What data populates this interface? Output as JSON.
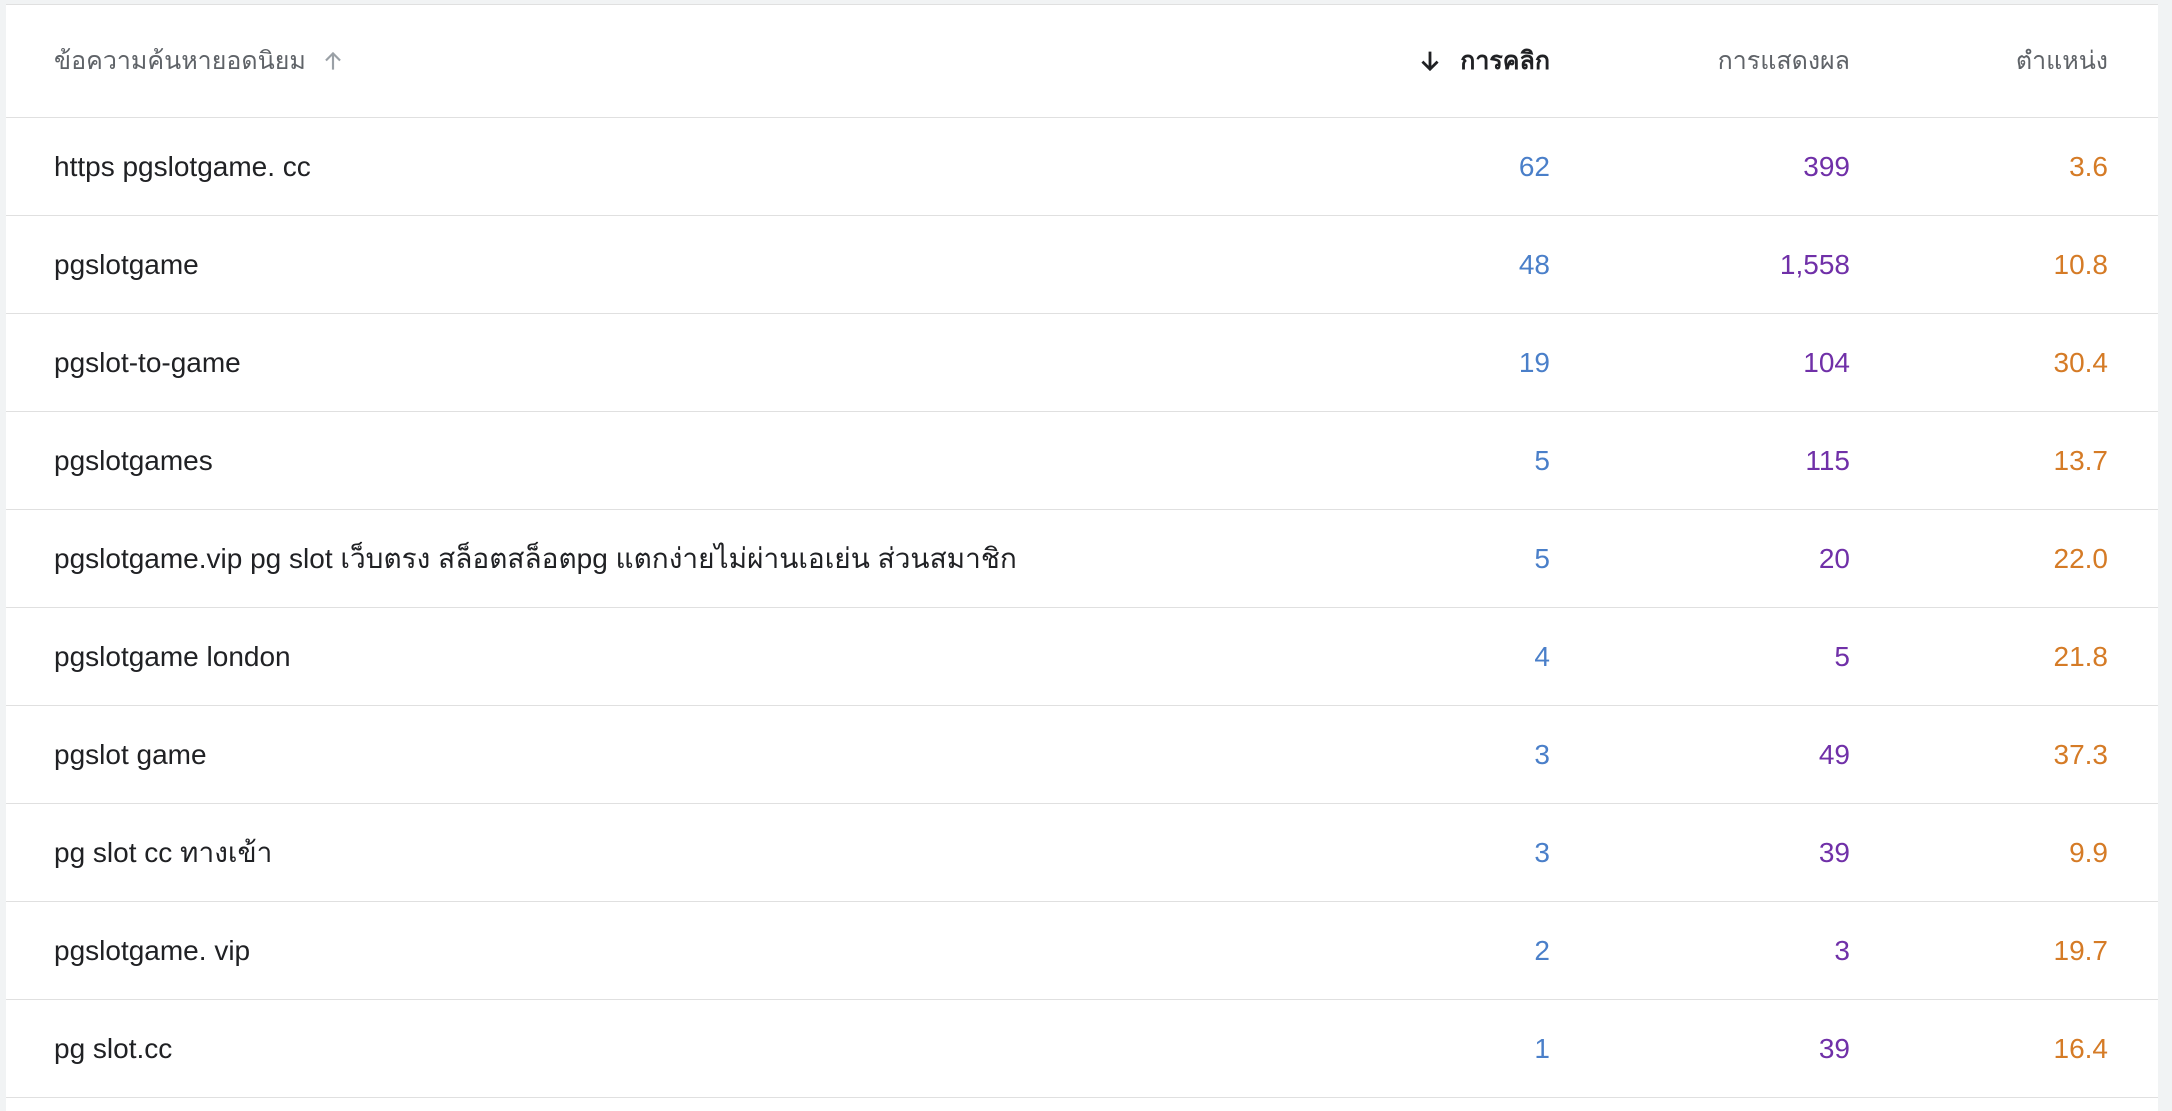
{
  "table": {
    "headers": {
      "query": "ข้อความค้นหายอดนิยม",
      "clicks": "การคลิก",
      "impressions": "การแสดงผล",
      "position": "ตำแหน่ง"
    },
    "rows": [
      {
        "query": "https pgslotgame. cc",
        "clicks": "62",
        "impressions": "399",
        "position": "3.6"
      },
      {
        "query": "pgslotgame",
        "clicks": "48",
        "impressions": "1,558",
        "position": "10.8"
      },
      {
        "query": "pgslot-to-game",
        "clicks": "19",
        "impressions": "104",
        "position": "30.4"
      },
      {
        "query": "pgslotgames",
        "clicks": "5",
        "impressions": "115",
        "position": "13.7"
      },
      {
        "query": "pgslotgame.vip pg slot เว็บตรง สล็อตสล็อตpg แตกง่ายไม่ผ่านเอเย่น ส่วนสมาชิก",
        "clicks": "5",
        "impressions": "20",
        "position": "22.0"
      },
      {
        "query": "pgslotgame london",
        "clicks": "4",
        "impressions": "5",
        "position": "21.8"
      },
      {
        "query": "pgslot game",
        "clicks": "3",
        "impressions": "49",
        "position": "37.3"
      },
      {
        "query": "pg slot cc ทางเข้า",
        "clicks": "3",
        "impressions": "39",
        "position": "9.9"
      },
      {
        "query": "pgslotgame. vip",
        "clicks": "2",
        "impressions": "3",
        "position": "19.7"
      },
      {
        "query": "pg slot.cc",
        "clicks": "1",
        "impressions": "39",
        "position": "16.4"
      }
    ]
  },
  "colors": {
    "clicks": "#4a7fc9",
    "impressions": "#7030a8",
    "position": "#d57b26"
  },
  "icons": {
    "query_sort": "arrow-up-icon",
    "clicks_sort": "arrow-down-icon"
  }
}
